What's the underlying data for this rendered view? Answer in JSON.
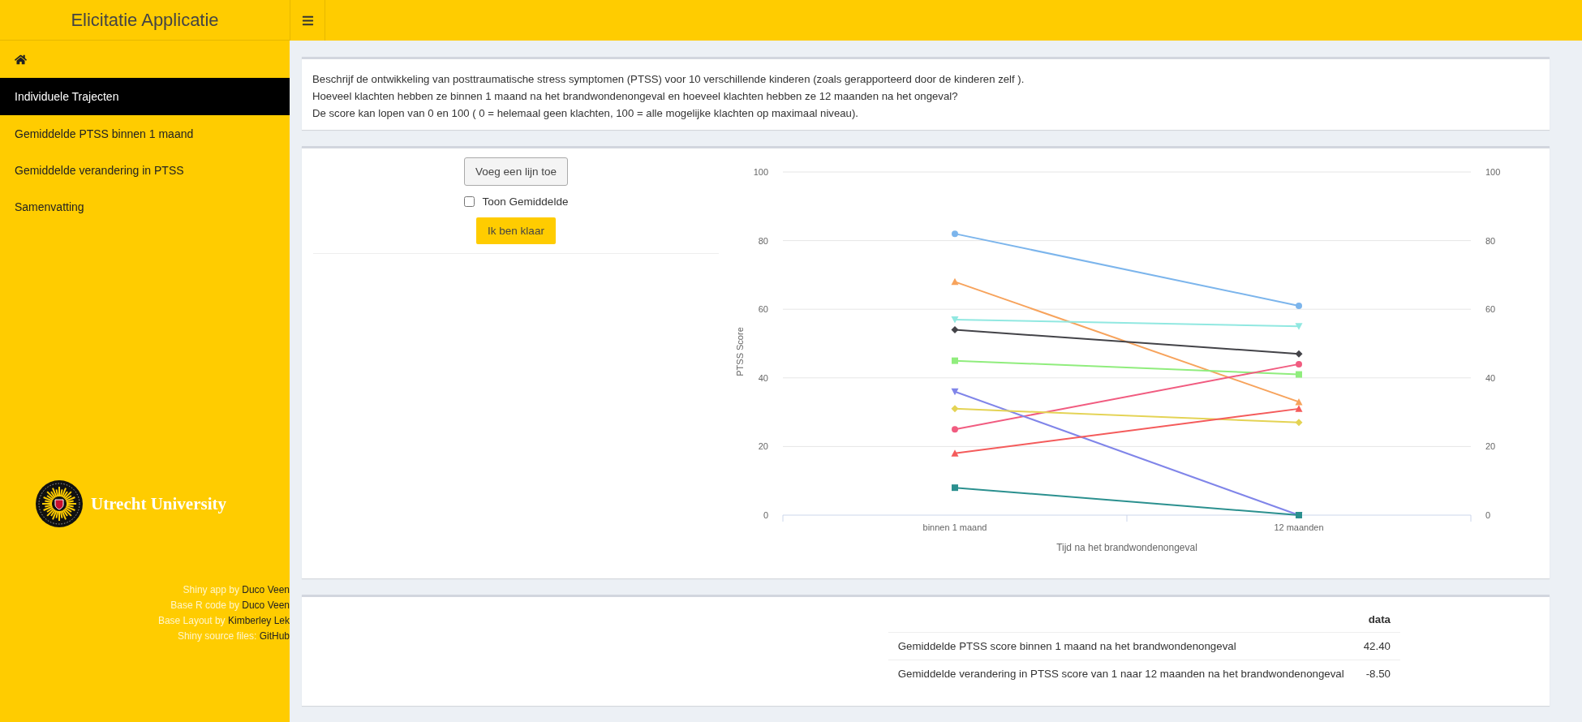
{
  "header": {
    "title": "Elicitatie Applicatie"
  },
  "sidebar": {
    "items": [
      {
        "kind": "home",
        "selected": false
      },
      {
        "kind": "text",
        "label": "Individuele Trajecten",
        "selected": true
      },
      {
        "kind": "text",
        "label": "Gemiddelde PTSS binnen 1 maand",
        "selected": false
      },
      {
        "kind": "text",
        "label": "Gemiddelde verandering in PTSS",
        "selected": false
      },
      {
        "kind": "text",
        "label": "Samenvatting",
        "selected": false
      }
    ]
  },
  "logo": {
    "text": "Utrecht University"
  },
  "credits": [
    {
      "label": "Shiny app by",
      "link": "Duco Veen"
    },
    {
      "label": "Base R code by",
      "link": "Duco Veen"
    },
    {
      "label": "Base Layout by",
      "link": "Kimberley Lek"
    },
    {
      "label": "Shiny source files:",
      "link": "GitHub"
    }
  ],
  "intro": {
    "lines": [
      "Beschrijf de ontwikkeling van posttraumatische stress symptomen (PTSS) voor 10 verschillende kinderen (zoals gerapporteerd door de kinderen zelf ).",
      "Hoeveel klachten hebben ze binnen 1 maand na het brandwondenongeval en hoeveel klachten hebben ze 12 maanden na het ongeval?",
      "De score kan lopen van 0 en 100 ( 0 = helemaal geen klachten, 100 = alle mogelijke klachten op maximaal niveau)."
    ]
  },
  "controls": {
    "add_button": "Voeg een lijn toe",
    "show_mean": {
      "label": "Toon Gemiddelde",
      "checked": false
    },
    "done_button": "Ik ben klaar"
  },
  "chart_data": {
    "type": "line",
    "xlabel": "Tijd na het brandwondenongeval",
    "ylabel": "PTSS Score",
    "categories": [
      "binnen 1 maand",
      "12 maanden"
    ],
    "ylim": [
      0,
      100
    ],
    "yticks": [
      0,
      20,
      40,
      60,
      80,
      100
    ],
    "grid": true,
    "series": [
      {
        "color": "#7cb5ec",
        "marker": "circle",
        "values": [
          82,
          61
        ]
      },
      {
        "color": "#f7a35c",
        "marker": "triangle",
        "values": [
          68,
          33
        ]
      },
      {
        "color": "#91e8e1",
        "marker": "triangle-down",
        "values": [
          57,
          55
        ]
      },
      {
        "color": "#434348",
        "marker": "diamond",
        "values": [
          54,
          47
        ]
      },
      {
        "color": "#90ed7d",
        "marker": "square",
        "values": [
          45,
          41
        ]
      },
      {
        "color": "#f15c80",
        "marker": "circle",
        "values": [
          25,
          44
        ]
      },
      {
        "color": "#8085e9",
        "marker": "triangle-down",
        "values": [
          36,
          0
        ]
      },
      {
        "color": "#e4d354",
        "marker": "diamond",
        "values": [
          31,
          27
        ]
      },
      {
        "color": "#f45b5b",
        "marker": "triangle",
        "values": [
          18,
          31
        ]
      },
      {
        "color": "#2b908f",
        "marker": "square",
        "values": [
          8,
          0
        ]
      }
    ]
  },
  "chart_right_axis": {
    "labels": [
      "100",
      "80",
      "60",
      "40",
      "20",
      "0"
    ]
  },
  "table": {
    "columns": [
      "data"
    ],
    "rows": [
      {
        "label": "Gemiddelde PTSS score binnen 1 maand na het brandwondenongeval",
        "value": "42.40"
      },
      {
        "label": "Gemiddelde verandering in PTSS score van 1 naar 12 maanden na het brandwondenongeval",
        "value": "-8.50"
      }
    ]
  }
}
